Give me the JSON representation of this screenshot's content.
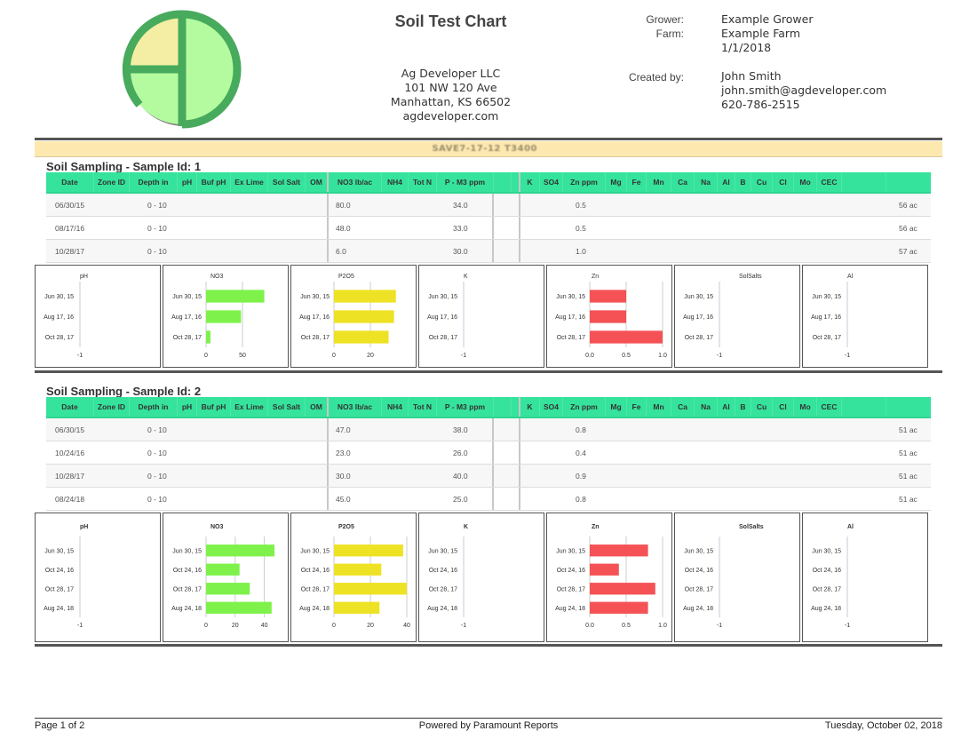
{
  "header": {
    "title": "Soil Test Chart",
    "company": {
      "name": "Ag Developer LLC",
      "address1": "101 NW 120 Ave",
      "address2": "Manhattan, KS 66502",
      "website": "agdeveloper.com"
    },
    "grower_label": "Grower:",
    "grower": "Example Grower",
    "farm_label": "Farm:",
    "farm": "Example Farm",
    "date": "1/1/2018",
    "created_by_label": "Created by:",
    "created_by": "John Smith",
    "email": "john.smith@agdeveloper.com",
    "phone": "620-786-2515"
  },
  "banner": {
    "text": "SAVE7-17-12 T3400"
  },
  "table_columns": [
    "Date",
    "Zone ID",
    "Depth in",
    "pH",
    "Buf pH",
    "Ex Lime",
    "Sol Salt",
    "OM",
    "NO3 lb/ac",
    "NH4",
    "Tot N",
    "P - M3 ppm",
    "",
    "",
    "K",
    "SO4",
    "Zn ppm",
    "Mg",
    "Fe",
    "Mn",
    "Ca",
    "Na",
    "Al",
    "B",
    "Cu",
    "Cl",
    "Mo",
    "CEC",
    ""
  ],
  "samples": [
    {
      "title": "Soil Sampling - Sample Id: 1",
      "rows": [
        {
          "date": "06/30/15",
          "depth": "0 - 10",
          "no3": "80.0",
          "p": "34.0",
          "zn": "0.5",
          "acres": "56 ac"
        },
        {
          "date": "08/17/16",
          "depth": "0 - 10",
          "no3": "48.0",
          "p": "33.0",
          "zn": "0.5",
          "acres": "56 ac"
        },
        {
          "date": "10/28/17",
          "depth": "0 - 10",
          "no3": "6.0",
          "p": "30.0",
          "zn": "1.0",
          "acres": "57 ac"
        }
      ]
    },
    {
      "title": "Soil Sampling - Sample Id: 2",
      "rows": [
        {
          "date": "06/30/15",
          "depth": "0 - 10",
          "no3": "47.0",
          "p": "38.0",
          "zn": "0.8",
          "acres": "51 ac"
        },
        {
          "date": "10/24/16",
          "depth": "0 - 10",
          "no3": "23.0",
          "p": "26.0",
          "zn": "0.4",
          "acres": "51 ac"
        },
        {
          "date": "10/28/17",
          "depth": "0 - 10",
          "no3": "30.0",
          "p": "40.0",
          "zn": "0.9",
          "acres": "51 ac"
        },
        {
          "date": "08/24/18",
          "depth": "0 - 10",
          "no3": "45.0",
          "p": "25.0",
          "zn": "0.8",
          "acres": "51 ac"
        }
      ]
    }
  ],
  "chart_data": [
    {
      "sample": 1,
      "type": "bar",
      "orientation": "horizontal",
      "title": "pH",
      "categories": [
        "Jun 30, 15",
        "Aug 17, 16",
        "Oct 28, 17"
      ],
      "values": [
        null,
        null,
        null
      ],
      "xlim": [
        -1,
        0
      ],
      "ticks": [
        "-1",
        "0"
      ],
      "color": null
    },
    {
      "sample": 1,
      "type": "bar",
      "orientation": "horizontal",
      "title": "NO3",
      "categories": [
        "Jun 30, 15",
        "Aug 17, 16",
        "Oct 28, 17"
      ],
      "values": [
        80,
        48,
        6
      ],
      "xlim": [
        0,
        100
      ],
      "ticks": [
        "0",
        "50"
      ],
      "tick_values": [
        0,
        50
      ],
      "color": "#7ef24a"
    },
    {
      "sample": 1,
      "type": "bar",
      "orientation": "horizontal",
      "title": "P2O5",
      "categories": [
        "Jun 30, 15",
        "Aug 17, 16",
        "Oct 28, 17"
      ],
      "values": [
        34,
        33,
        30
      ],
      "xlim": [
        0,
        40
      ],
      "ticks": [
        "0",
        "20"
      ],
      "tick_values": [
        0,
        20
      ],
      "color": "#eee224"
    },
    {
      "sample": 1,
      "type": "bar",
      "orientation": "horizontal",
      "title": "K",
      "categories": [
        "Jun 30, 15",
        "Aug 17, 16",
        "Oct 28, 17"
      ],
      "values": [
        null,
        null,
        null
      ],
      "xlim": [
        -1,
        0
      ],
      "ticks": [
        "-1",
        "0"
      ],
      "color": null
    },
    {
      "sample": 1,
      "type": "bar",
      "orientation": "horizontal",
      "title": "Zn",
      "categories": [
        "Jun 30, 15",
        "Aug 17, 16",
        "Oct 28, 17"
      ],
      "values": [
        0.5,
        0.5,
        1.0
      ],
      "xlim": [
        0,
        1
      ],
      "ticks": [
        "0.0",
        "0.5",
        "1.0"
      ],
      "tick_values": [
        0,
        0.5,
        1.0
      ],
      "color": "#f55256"
    },
    {
      "sample": 1,
      "type": "bar",
      "orientation": "horizontal",
      "title": "SolSalts",
      "categories": [
        "Jun 30, 15",
        "Aug 17, 16",
        "Oct 28, 17"
      ],
      "values": [
        null,
        null,
        null
      ],
      "xlim": [
        -1,
        0
      ],
      "ticks": [
        "-1",
        "0"
      ],
      "color": null
    },
    {
      "sample": 1,
      "type": "bar",
      "orientation": "horizontal",
      "title": "Al",
      "categories": [
        "Jun 30, 15",
        "Aug 17, 16",
        "Oct 28, 17"
      ],
      "values": [
        null,
        null,
        null
      ],
      "xlim": [
        -1,
        0
      ],
      "ticks": [
        "-1",
        "0"
      ],
      "color": null
    },
    {
      "sample": 2,
      "type": "bar",
      "orientation": "horizontal",
      "title": "pH",
      "categories": [
        "Jun 30, 15",
        "Oct 24, 16",
        "Oct 28, 17",
        "Aug 24, 18"
      ],
      "values": [
        null,
        null,
        null,
        null
      ],
      "xlim": [
        -1,
        0
      ],
      "ticks": [
        "-1",
        "0"
      ],
      "color": null
    },
    {
      "sample": 2,
      "type": "bar",
      "orientation": "horizontal",
      "title": "NO3",
      "categories": [
        "Jun 30, 15",
        "Oct 24, 16",
        "Oct 28, 17",
        "Aug 24, 18"
      ],
      "values": [
        47,
        23,
        30,
        45
      ],
      "xlim": [
        0,
        50
      ],
      "ticks": [
        "0",
        "20",
        "40"
      ],
      "tick_values": [
        0,
        20,
        40
      ],
      "color": "#7ef24a"
    },
    {
      "sample": 2,
      "type": "bar",
      "orientation": "horizontal",
      "title": "P2O5",
      "categories": [
        "Jun 30, 15",
        "Oct 24, 16",
        "Oct 28, 17",
        "Aug 24, 18"
      ],
      "values": [
        38,
        26,
        40,
        25
      ],
      "xlim": [
        0,
        40
      ],
      "ticks": [
        "0",
        "20",
        "40"
      ],
      "tick_values": [
        0,
        20,
        40
      ],
      "color": "#eee224"
    },
    {
      "sample": 2,
      "type": "bar",
      "orientation": "horizontal",
      "title": "K",
      "categories": [
        "Jun 30, 15",
        "Oct 24, 16",
        "Oct 28, 17",
        "Aug 24, 18"
      ],
      "values": [
        null,
        null,
        null,
        null
      ],
      "xlim": [
        -1,
        0
      ],
      "ticks": [
        "-1",
        "0"
      ],
      "color": null
    },
    {
      "sample": 2,
      "type": "bar",
      "orientation": "horizontal",
      "title": "Zn",
      "categories": [
        "Jun 30, 15",
        "Oct 24, 16",
        "Oct 28, 17",
        "Aug 24, 18"
      ],
      "values": [
        0.8,
        0.4,
        0.9,
        0.8
      ],
      "xlim": [
        0,
        1
      ],
      "ticks": [
        "0.0",
        "0.5",
        "1.0"
      ],
      "tick_values": [
        0,
        0.5,
        1.0
      ],
      "color": "#f55256"
    },
    {
      "sample": 2,
      "type": "bar",
      "orientation": "horizontal",
      "title": "SolSalts",
      "categories": [
        "Jun 30, 15",
        "Oct 24, 16",
        "Oct 28, 17",
        "Aug 24, 18"
      ],
      "values": [
        null,
        null,
        null,
        null
      ],
      "xlim": [
        -1,
        0
      ],
      "ticks": [
        "-1",
        "0"
      ],
      "color": null
    },
    {
      "sample": 2,
      "type": "bar",
      "orientation": "horizontal",
      "title": "Al",
      "categories": [
        "Jun 30, 15",
        "Oct 24, 16",
        "Oct 28, 17",
        "Aug 24, 18"
      ],
      "values": [
        null,
        null,
        null,
        null
      ],
      "xlim": [
        -1,
        0
      ],
      "ticks": [
        "-1",
        "0"
      ],
      "color": null
    }
  ],
  "footer": {
    "page": "Page 1 of 2",
    "powered_by": "Powered by Paramount Reports",
    "date": "Tuesday, October 02, 2018"
  },
  "colors": {
    "table_header": "#35e39c",
    "banner": "#fde9b0",
    "no3_bar": "#7ef24a",
    "p2o5_bar": "#eee224",
    "zn_bar": "#f55256"
  }
}
